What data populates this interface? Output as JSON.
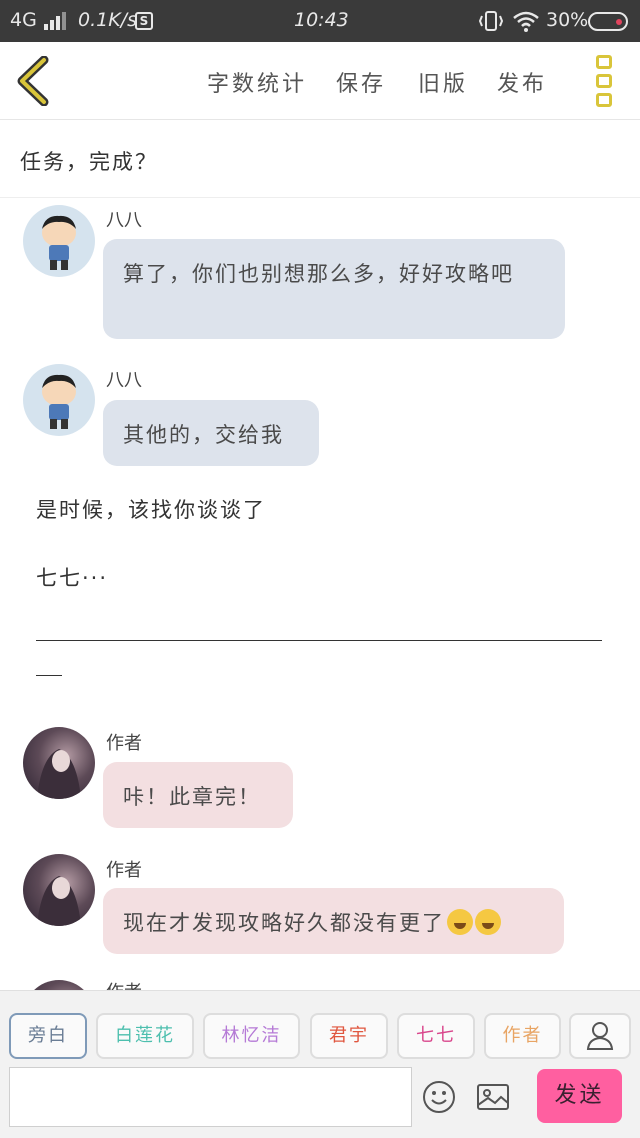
{
  "status_bar": {
    "network": "4G",
    "speed": "0.1K/s",
    "sd_label": "S",
    "time": "10:43",
    "battery": "30%"
  },
  "toolbar": {
    "back_icon": "chevron-left-icon",
    "word_count_label": "字数统计",
    "save_label": "保存",
    "old_version_label": "旧版",
    "publish_label": "发布",
    "menu_icon": "menu-icon",
    "accent_color": "#d9c53a"
  },
  "chapter": {
    "title": "任务，完成？"
  },
  "messages": [
    {
      "speaker": "八八",
      "text": "算了，你们也别想那么多，好好攻略吧"
    },
    {
      "speaker": "八八",
      "text": "其他的，交给我"
    },
    {
      "narration": "是时候，该找你谈谈了"
    },
    {
      "narration": "七七···"
    },
    {
      "speaker": "作者",
      "text": "咔！此章完！"
    },
    {
      "speaker": "作者",
      "text": "现在才发现攻略好久都没有更了"
    },
    {
      "speaker": "作者"
    }
  ],
  "role_tabs": [
    {
      "label": "旁白",
      "color": "#6a7d95"
    },
    {
      "label": "白莲花",
      "color": "#4dbfae"
    },
    {
      "label": "林忆洁",
      "color": "#b57ad6"
    },
    {
      "label": "君宇",
      "color": "#e0563f"
    },
    {
      "label": "七七",
      "color": "#d9468c"
    },
    {
      "label": "作者",
      "color": "#e8a463"
    }
  ],
  "input": {
    "value": "",
    "placeholder": ""
  },
  "icons": {
    "person": "person-icon",
    "emoji": "smiley-icon",
    "image": "image-icon"
  },
  "send": {
    "label": "发送",
    "color": "#ff5fa0"
  }
}
